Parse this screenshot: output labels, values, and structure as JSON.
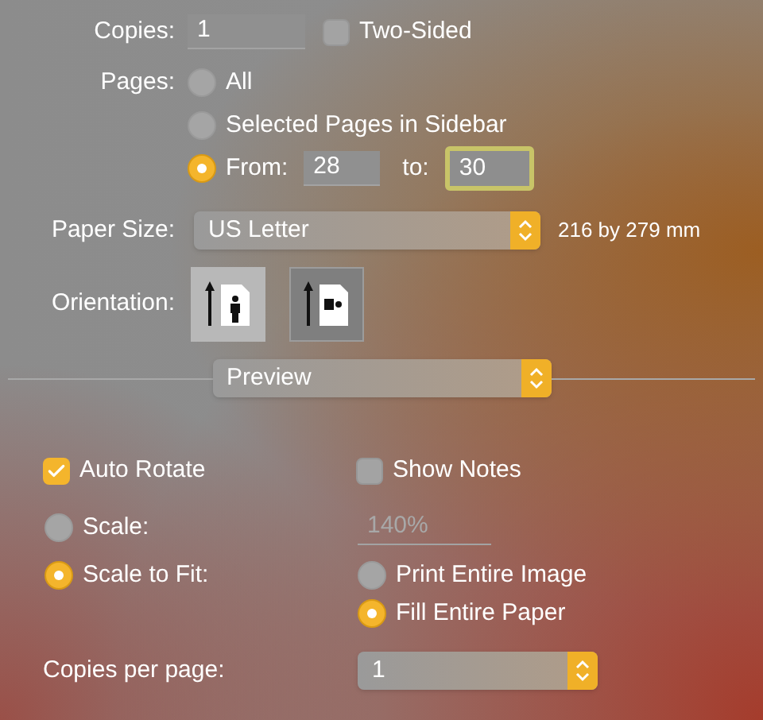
{
  "copies": {
    "label": "Copies:",
    "value": "1"
  },
  "two_sided": {
    "label": "Two-Sided",
    "checked": false
  },
  "pages": {
    "label": "Pages:",
    "options": [
      {
        "label": "All",
        "selected": false
      },
      {
        "label": "Selected Pages in Sidebar",
        "selected": false
      },
      {
        "label": "From:",
        "selected": true
      }
    ],
    "from": {
      "value": "28"
    },
    "to": {
      "label": "to:",
      "value": "30",
      "focused": true
    }
  },
  "paper_size": {
    "label": "Paper Size:",
    "value": "US Letter",
    "dimensions": "216 by 279 mm"
  },
  "orientation": {
    "label": "Orientation:",
    "options": [
      {
        "kind": "portrait",
        "selected": true
      },
      {
        "kind": "landscape",
        "selected": false
      }
    ]
  },
  "section_popup": {
    "value": "Preview"
  },
  "auto_rotate": {
    "label": "Auto Rotate",
    "checked": true
  },
  "show_notes": {
    "label": "Show Notes",
    "checked": false
  },
  "scale_modes": [
    {
      "label": "Scale:",
      "selected": false
    },
    {
      "label": "Scale to Fit:",
      "selected": true
    }
  ],
  "scale_field": {
    "value": "140%",
    "disabled": true
  },
  "fit_options": [
    {
      "label": "Print Entire Image",
      "selected": false
    },
    {
      "label": "Fill Entire Paper",
      "selected": true
    }
  ],
  "copies_per_page": {
    "label": "Copies per page:",
    "value": "1"
  }
}
